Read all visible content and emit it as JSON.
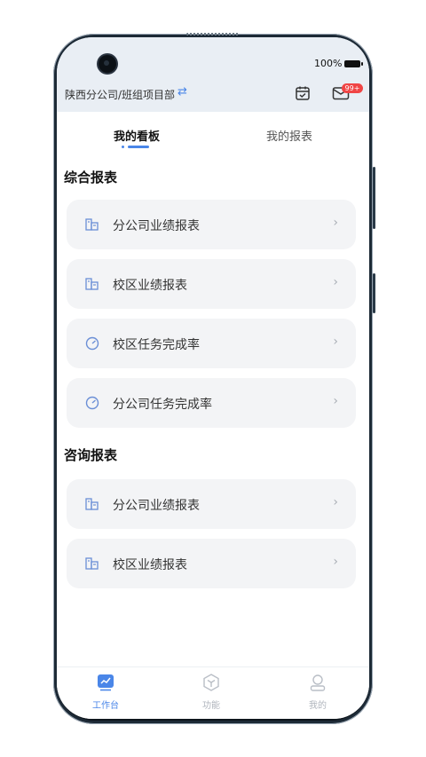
{
  "status_bar": {
    "battery": "100%"
  },
  "header": {
    "org": "陕西分公司/班组项目部",
    "swap_icon": "swap-icon",
    "calendar_icon": "calendar-check-icon",
    "mail_icon": "mail-icon",
    "badge": "99+"
  },
  "tabs": [
    {
      "label": "我的看板",
      "active": true
    },
    {
      "label": "我的报表",
      "active": false
    }
  ],
  "sections": [
    {
      "title": "综合报表",
      "items": [
        {
          "label": "分公司业绩报表",
          "icon": "building-chart-icon"
        },
        {
          "label": "校区业绩报表",
          "icon": "building-chart-icon"
        },
        {
          "label": "校区任务完成率",
          "icon": "gauge-icon"
        },
        {
          "label": "分公司任务完成率",
          "icon": "gauge-icon"
        }
      ]
    },
    {
      "title": "咨询报表",
      "items": [
        {
          "label": "分公司业绩报表",
          "icon": "building-chart-icon"
        },
        {
          "label": "校区业绩报表",
          "icon": "building-chart-icon"
        }
      ]
    }
  ],
  "bottom_nav": [
    {
      "label": "工作台",
      "icon": "workbench-icon",
      "active": true
    },
    {
      "label": "功能",
      "icon": "cube-icon",
      "active": false
    },
    {
      "label": "我的",
      "icon": "person-icon",
      "active": false
    }
  ],
  "colors": {
    "accent": "#4a86e8",
    "badge": "#f04545",
    "card_bg": "#f3f4f6",
    "header_bg": "#e9eef4"
  }
}
